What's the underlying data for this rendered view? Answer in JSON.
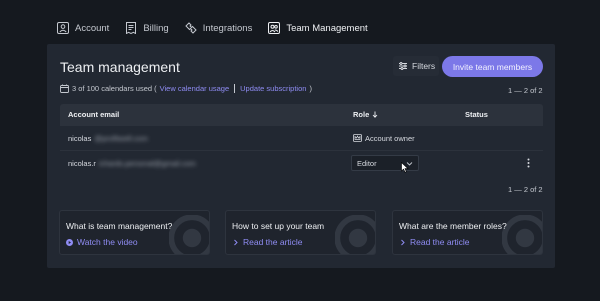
{
  "tabs": [
    {
      "label": "Account",
      "icon": "person-icon"
    },
    {
      "label": "Billing",
      "icon": "receipt-icon"
    },
    {
      "label": "Integrations",
      "icon": "puzzle-icon"
    },
    {
      "label": "Team Management",
      "icon": "team-icon"
    }
  ],
  "header": {
    "title": "Team management",
    "filters_label": "Filters",
    "invite_label": "Invite team members"
  },
  "usage": {
    "text": "3 of 100 calendars used (",
    "link1": "View calendar usage",
    "link2": "Update subscription",
    "close": ")"
  },
  "pagination": {
    "top": "1 — 2 of 2",
    "bottom": "1 — 2 of 2"
  },
  "table": {
    "columns": [
      "Account email",
      "Role",
      "Status"
    ],
    "rows": [
      {
        "email_visible": "nicolas",
        "email_hidden": "@profitwell.com",
        "role": "Account owner",
        "role_type": "text"
      },
      {
        "email_visible": "nicolas.r",
        "email_hidden": "ichards.personal@gmail.com",
        "role": "Editor",
        "role_type": "select"
      }
    ]
  },
  "cards": [
    {
      "title": "What is team management?",
      "link": "Watch the video",
      "link_icon": "play-circle-icon"
    },
    {
      "title": "How to set up your team",
      "link": "Read the article",
      "link_icon": "chevron-right-icon"
    },
    {
      "title": "What are the member roles?",
      "link": "Read the article",
      "link_icon": "chevron-right-icon"
    }
  ],
  "colors": {
    "background": "#15191f",
    "panel": "#222832",
    "accent": "#7c78e8",
    "link": "#8f8cf3"
  }
}
